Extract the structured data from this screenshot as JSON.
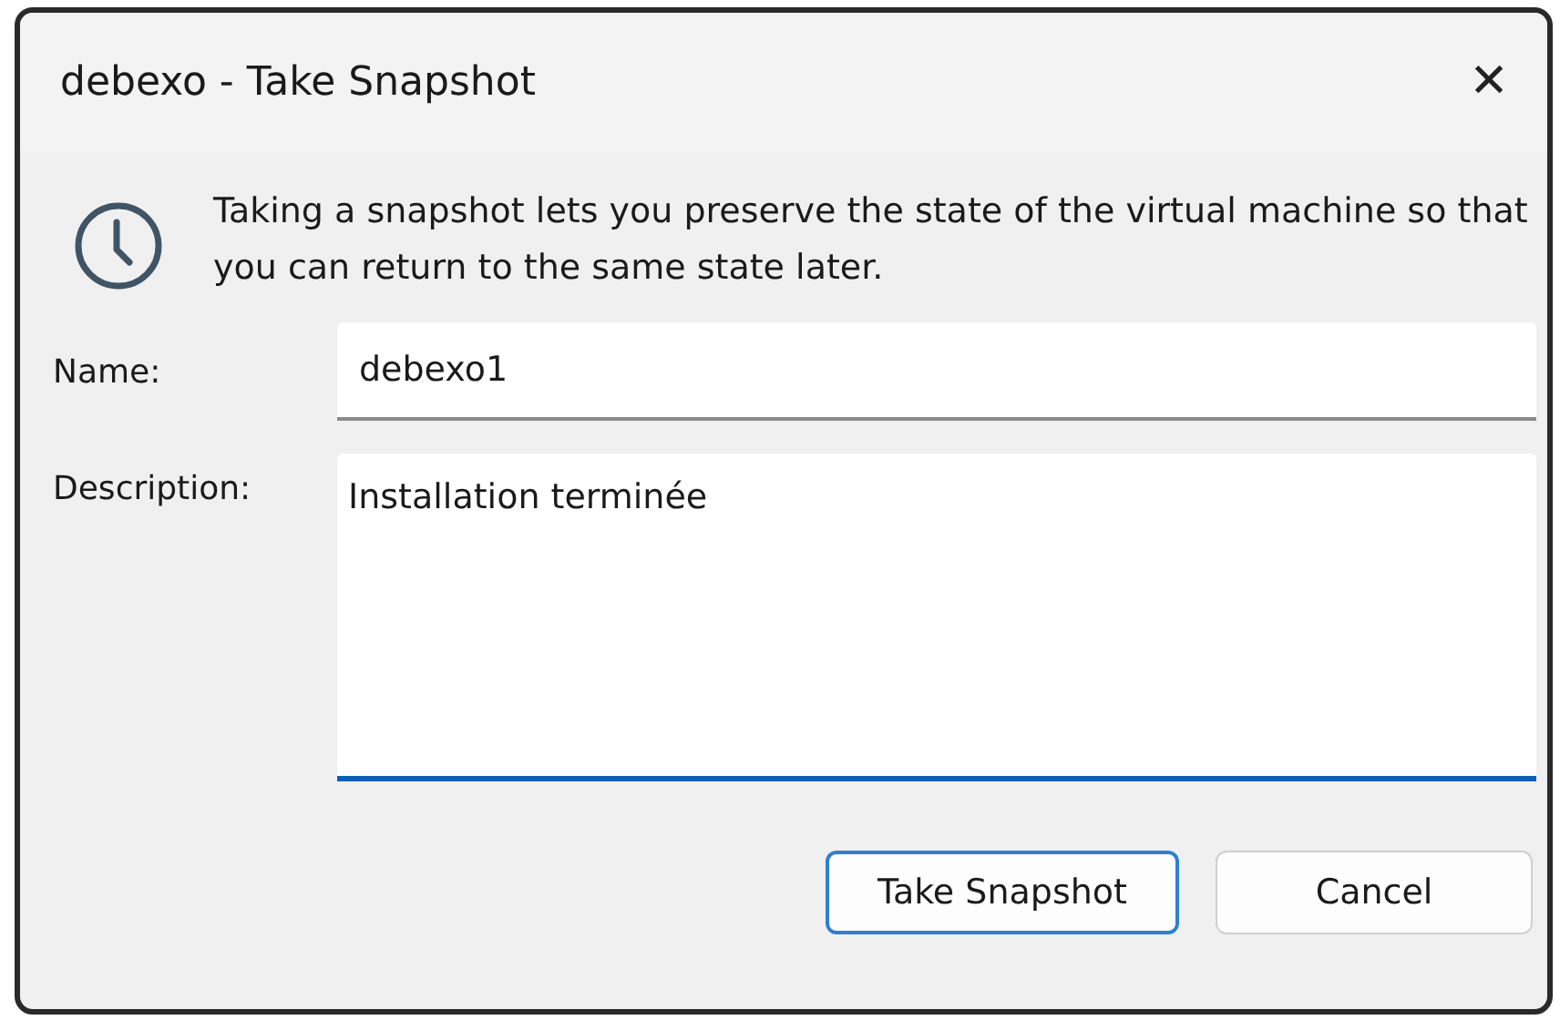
{
  "window": {
    "title": "debexo - Take Snapshot",
    "close_label": "✕"
  },
  "message": "Taking a snapshot lets you preserve the state of the virtual machine so that you can return to the same state later.",
  "fields": [
    {
      "kind": "line",
      "label": "Name:",
      "value": "debexo1",
      "focused": false
    },
    {
      "kind": "multiline",
      "label": "Description:",
      "value": "Installation terminée",
      "focused": true
    }
  ],
  "buttons": [
    {
      "label": "Take Snapshot",
      "default": true
    },
    {
      "label": "Cancel",
      "default": false
    }
  ]
}
